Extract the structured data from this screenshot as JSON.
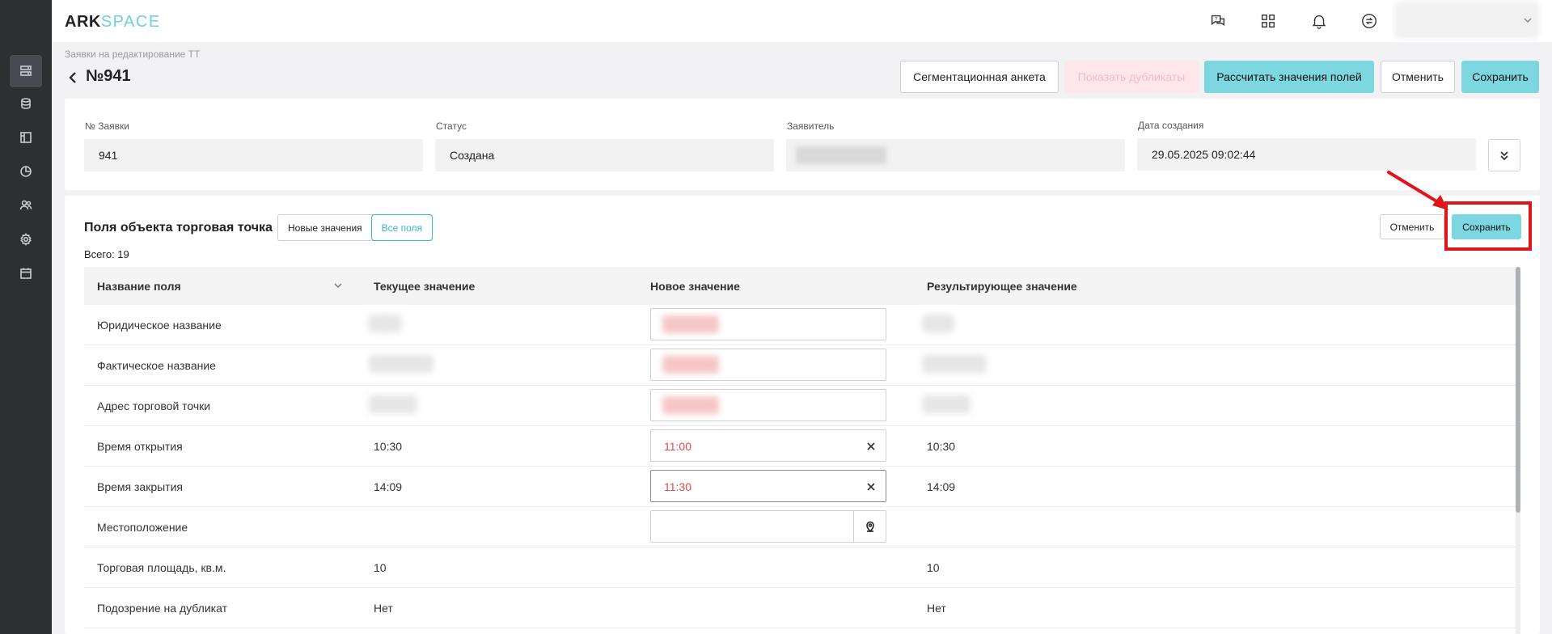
{
  "app": {
    "logo_primary": "ARK",
    "logo_secondary": "SPACE"
  },
  "sidebar": {
    "items": [
      {
        "icon": "requests-icon",
        "active": true
      },
      {
        "icon": "database-icon"
      },
      {
        "icon": "layout-icon"
      },
      {
        "icon": "chart-icon"
      },
      {
        "icon": "users-icon"
      },
      {
        "icon": "settings-icon"
      },
      {
        "icon": "calendar-icon"
      }
    ]
  },
  "topbar": {
    "icons": [
      "support-chat-icon",
      "apps-grid-icon",
      "bell-icon",
      "sync-icon"
    ]
  },
  "header": {
    "breadcrumb": "Заявки на редактирование ТТ",
    "title": "№941",
    "buttons": {
      "segmentation": "Сегментационная анкета",
      "duplicates": "Показать дубликаты",
      "calculate": "Рассчитать значения полей",
      "cancel": "Отменить",
      "save": "Сохранить"
    }
  },
  "info": {
    "request_no_label": "№ Заявки",
    "request_no": "941",
    "status_label": "Статус",
    "status": "Создана",
    "applicant_label": "Заявитель",
    "applicant": "",
    "created_label": "Дата создания",
    "created": "29.05.2025 09:02:44"
  },
  "fields_section": {
    "title": "Поля объекта торговая точка",
    "toggle_new": "Новые значения",
    "toggle_all": "Все поля",
    "total": "Всего: 19",
    "cancel": "Отменить",
    "save": "Сохранить",
    "columns": [
      "Название поля",
      "Текущее значение",
      "Новое значение",
      "Результирующее значение"
    ],
    "rows": [
      {
        "name": "Юридическое название",
        "current": "",
        "new": "",
        "result": ""
      },
      {
        "name": "Фактическое название",
        "current": "",
        "new": "",
        "result": ""
      },
      {
        "name": "Адрес торговой точки",
        "current": "",
        "new": "",
        "result": ""
      },
      {
        "name": "Время открытия",
        "current": "10:30",
        "new": "11:00",
        "result": "10:30"
      },
      {
        "name": "Время закрытия",
        "current": "14:09",
        "new": "11:30",
        "result": "14:09"
      },
      {
        "name": "Местоположение",
        "current": "",
        "new": "",
        "result": ""
      },
      {
        "name": "Торговая площадь, кв.м.",
        "current": "10",
        "new": "",
        "result": "10"
      },
      {
        "name": "Подозрение на дубликат",
        "current": "Нет",
        "new": "",
        "result": "Нет"
      }
    ]
  },
  "colors": {
    "accent": "#7dd7e1",
    "highlight": "#e0141b",
    "changed_value": "#e24b4b"
  }
}
